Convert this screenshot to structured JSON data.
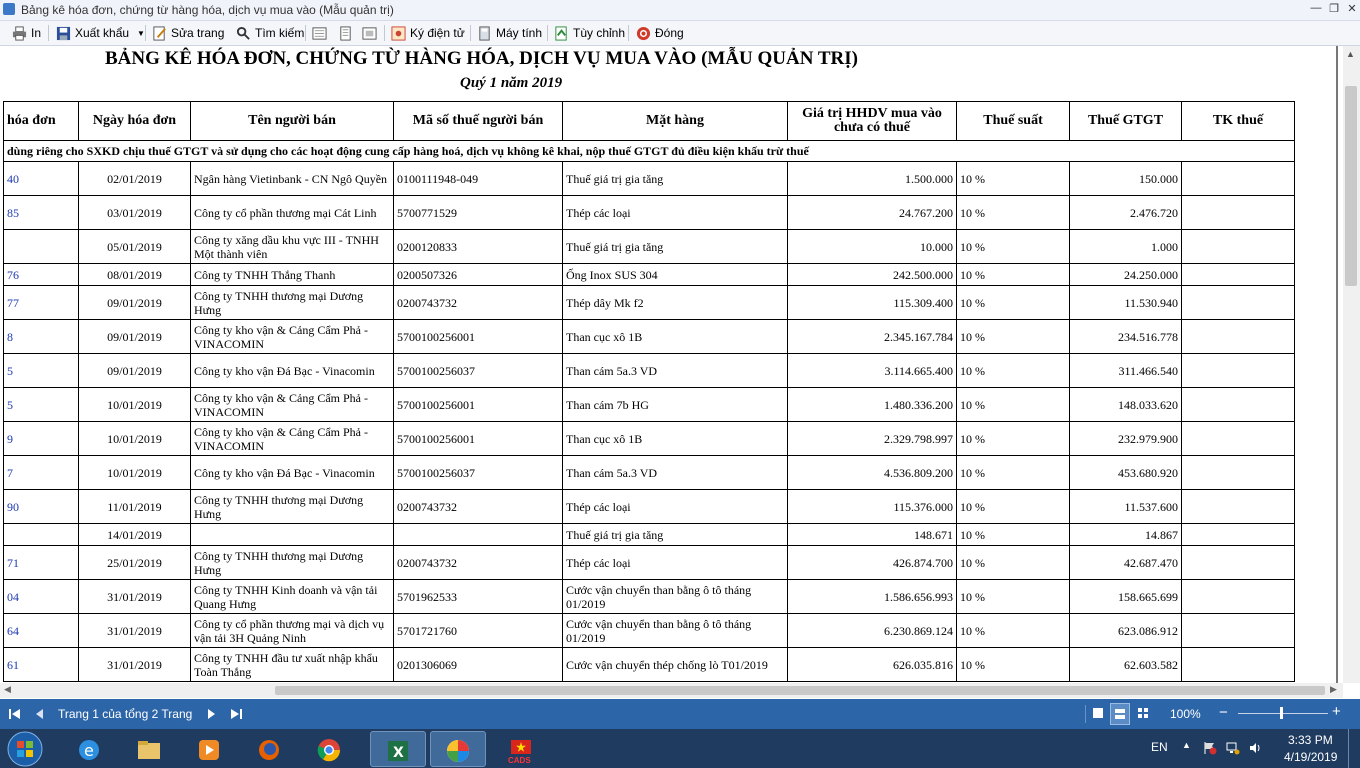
{
  "window": {
    "title": "Bảng kê hóa đơn, chứng từ hàng hóa, dịch vụ mua vào (Mẫu quản trị)"
  },
  "toolbar": {
    "print": "In",
    "export": "Xuất khẩu",
    "edit_page": "Sửa trang",
    "search": "Tìm kiếm",
    "sign": "Ký điện tử",
    "calculator": "Máy tính",
    "options": "Tùy chỉnh",
    "close": "Đóng"
  },
  "report": {
    "title": "BẢNG KÊ HÓA ĐƠN, CHỨNG TỪ HÀNG HÓA, DỊCH VỤ MUA VÀO (MẪU QUẢN TRỊ)",
    "subtitle": "Quý 1 năm 2019",
    "columns": [
      "hóa đơn",
      "Ngày hóa đơn",
      "Tên người bán",
      "Mã số thuế người bán",
      "Mặt hàng",
      "Giá trị HHDV mua vào chưa có thuế",
      "Thuế suất",
      "Thuế GTGT",
      "TK thuế"
    ],
    "section": "dùng riêng cho SXKD chịu thuế GTGT và sử dụng cho các hoạt động cung cấp hàng hoá, dịch vụ không kê khai, nộp thuế GTGT đủ điều kiện khấu trừ thuế",
    "rows": [
      {
        "no": "40",
        "date": "02/01/2019",
        "seller": "Ngân hàng Vietinbank - CN Ngô Quyền",
        "tax_id": "0100111948-049",
        "item": "Thuế giá trị gia tăng",
        "value": "1.500.000",
        "rate": "10 %",
        "vat": "150.000",
        "account": ""
      },
      {
        "no": "85",
        "date": "03/01/2019",
        "seller": "Công ty cổ phần thương mại Cát Linh",
        "tax_id": "5700771529",
        "item": "Thép các loại",
        "value": "24.767.200",
        "rate": "10 %",
        "vat": "2.476.720",
        "account": ""
      },
      {
        "no": "",
        "date": "05/01/2019",
        "seller": "Công ty xăng dầu khu vực III - TNHH Một thành viên",
        "tax_id": "0200120833",
        "item": "Thuế giá trị gia tăng",
        "value": "10.000",
        "rate": "10 %",
        "vat": "1.000",
        "account": ""
      },
      {
        "no": "76",
        "date": "08/01/2019",
        "seller": "Công ty TNHH Thắng Thanh",
        "tax_id": "0200507326",
        "item": "Ống Inox SUS 304",
        "value": "242.500.000",
        "rate": "10 %",
        "vat": "24.250.000",
        "account": ""
      },
      {
        "no": "77",
        "date": "09/01/2019",
        "seller": "Công ty TNHH thương mại Dương Hưng",
        "tax_id": "0200743732",
        "item": "Thép dây Mk f2",
        "value": "115.309.400",
        "rate": "10 %",
        "vat": "11.530.940",
        "account": ""
      },
      {
        "no": "8",
        "date": "09/01/2019",
        "seller": "Công ty kho vận & Cảng Cẩm Phả - VINACOMIN",
        "tax_id": "5700100256001",
        "item": "Than cục xô 1B",
        "value": "2.345.167.784",
        "rate": "10 %",
        "vat": "234.516.778",
        "account": ""
      },
      {
        "no": "5",
        "date": "09/01/2019",
        "seller": "Công ty kho vận Đá Bạc - Vinacomin",
        "tax_id": "5700100256037",
        "item": "Than cám 5a.3 VD",
        "value": "3.114.665.400",
        "rate": "10 %",
        "vat": "311.466.540",
        "account": ""
      },
      {
        "no": "5",
        "date": "10/01/2019",
        "seller": "Công ty kho vận & Cảng Cẩm Phả - VINACOMIN",
        "tax_id": "5700100256001",
        "item": "Than cám 7b HG",
        "value": "1.480.336.200",
        "rate": "10 %",
        "vat": "148.033.620",
        "account": ""
      },
      {
        "no": "9",
        "date": "10/01/2019",
        "seller": "Công ty kho vận & Cảng Cẩm Phả - VINACOMIN",
        "tax_id": "5700100256001",
        "item": "Than cục xô 1B",
        "value": "2.329.798.997",
        "rate": "10 %",
        "vat": "232.979.900",
        "account": ""
      },
      {
        "no": "7",
        "date": "10/01/2019",
        "seller": "Công ty kho vận Đá Bạc - Vinacomin",
        "tax_id": "5700100256037",
        "item": "Than cám 5a.3 VD",
        "value": "4.536.809.200",
        "rate": "10 %",
        "vat": "453.680.920",
        "account": ""
      },
      {
        "no": "90",
        "date": "11/01/2019",
        "seller": "Công ty TNHH thương mại Dương Hưng",
        "tax_id": "0200743732",
        "item": "Thép các loại",
        "value": "115.376.000",
        "rate": "10 %",
        "vat": "11.537.600",
        "account": ""
      },
      {
        "no": "",
        "date": "14/01/2019",
        "seller": "",
        "tax_id": "",
        "item": "Thuế giá trị gia tăng",
        "value": "148.671",
        "rate": "10 %",
        "vat": "14.867",
        "account": ""
      },
      {
        "no": "71",
        "date": "25/01/2019",
        "seller": "Công ty TNHH thương mại Dương Hưng",
        "tax_id": "0200743732",
        "item": "Thép các loại",
        "value": "426.874.700",
        "rate": "10 %",
        "vat": "42.687.470",
        "account": ""
      },
      {
        "no": "04",
        "date": "31/01/2019",
        "seller": "Công ty TNHH Kinh doanh và vận tải Quang Hưng",
        "tax_id": "5701962533",
        "item": "Cước vận chuyển than bằng ô tô tháng 01/2019",
        "value": "1.586.656.993",
        "rate": "10 %",
        "vat": "158.665.699",
        "account": ""
      },
      {
        "no": "64",
        "date": "31/01/2019",
        "seller": "Công ty cổ phần thương mại và dịch vụ vận tải 3H Quảng Ninh",
        "tax_id": "5701721760",
        "item": "Cước vận chuyển than bằng ô tô tháng 01/2019",
        "value": "6.230.869.124",
        "rate": "10 %",
        "vat": "623.086.912",
        "account": ""
      },
      {
        "no": "61",
        "date": "31/01/2019",
        "seller": "Công ty TNHH đầu tư xuất nhập khẩu Toàn Thắng",
        "tax_id": "0201306069",
        "item": "Cước vận chuyển thép chống lò T01/2019",
        "value": "626.035.816",
        "rate": "10 %",
        "vat": "62.603.582",
        "account": ""
      }
    ]
  },
  "status": {
    "page_info": "Trang 1 của tổng 2 Trang",
    "zoom": "100%",
    "zoom_minus": "−",
    "zoom_plus": "+"
  },
  "taskbar": {
    "lang": "EN",
    "time": "3:33 PM",
    "date": "4/19/2019",
    "cads_label": "CADS"
  },
  "colors": {
    "statusbar": "#2d66a8",
    "taskbar": "#1f3b60",
    "invoice_no": "#1d3ab5"
  }
}
